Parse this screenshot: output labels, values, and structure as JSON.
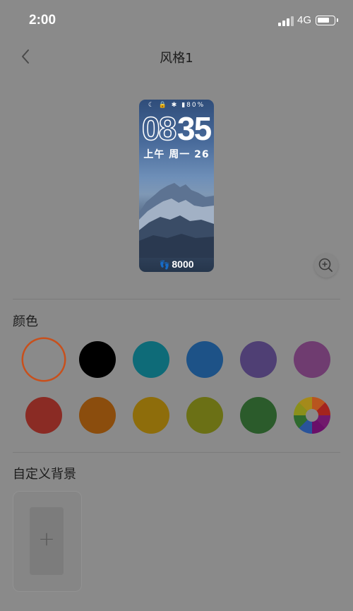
{
  "status_bar": {
    "time": "2:00",
    "network": "4G"
  },
  "nav": {
    "title": "风格1"
  },
  "preview": {
    "status_icons": "☾ 🔒 ✱ ▮80%",
    "hour": "08",
    "minute": "35",
    "date": "上午 周一 26",
    "steps": "8000"
  },
  "colors_section": {
    "title": "颜色",
    "swatches": [
      {
        "name": "white",
        "color": "#8a8a8a",
        "selected": true
      },
      {
        "name": "black",
        "color": "#000000"
      },
      {
        "name": "teal",
        "color": "#0e6b78"
      },
      {
        "name": "blue",
        "color": "#1d5287"
      },
      {
        "name": "indigo",
        "color": "#4f3f74"
      },
      {
        "name": "purple",
        "color": "#6f3c70"
      },
      {
        "name": "red",
        "color": "#8a2b24"
      },
      {
        "name": "orange",
        "color": "#8b4d0d"
      },
      {
        "name": "amber",
        "color": "#8e6d0b"
      },
      {
        "name": "olive",
        "color": "#6b7015"
      },
      {
        "name": "green",
        "color": "#2b5b2b"
      },
      {
        "name": "multicolor",
        "color": "multi"
      }
    ]
  },
  "custom_bg": {
    "title": "自定义背景",
    "add_label": "+"
  }
}
